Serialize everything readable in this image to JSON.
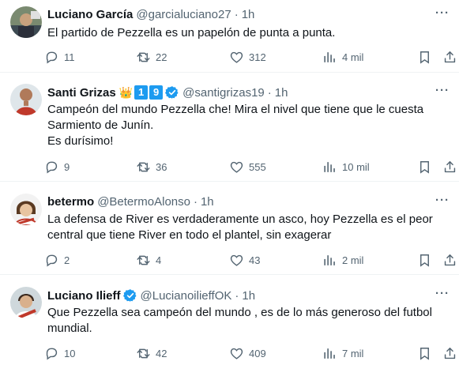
{
  "tweets": [
    {
      "name": "Luciano García",
      "handle": "@garcialuciano27",
      "time": "1h",
      "lines": [
        "El partido de Pezzella es un papelón de punta a punta."
      ],
      "replies": "11",
      "retweets": "22",
      "likes": "312",
      "views": "4 mil"
    },
    {
      "name": "Santi Grizas",
      "badge_emoji": "👑",
      "badge_nums": [
        "1",
        "9"
      ],
      "handle": "@santigrizas19",
      "time": "1h",
      "lines": [
        "Campeón del mundo Pezzella che! Mira el nivel que tiene que le cuesta",
        "Sarmiento de Junín.",
        "Es durísimo!"
      ],
      "replies": "9",
      "retweets": "36",
      "likes": "555",
      "views": "10 mil"
    },
    {
      "name": "betermo",
      "handle": "@BetermoAlonso",
      "time": "1h",
      "lines": [
        "La defensa de River es verdaderamente un asco, hoy Pezzella es el peor",
        "central que tiene River en todo el plantel, sin exagerar"
      ],
      "replies": "2",
      "retweets": "4",
      "likes": "43",
      "views": "2 mil"
    },
    {
      "name": "Luciano Ilieff",
      "handle": "@LucianoilieffOK",
      "time": "1h",
      "lines": [
        "Que Pezzella sea campeón del mundo , es de lo más generoso del futbol",
        "mundial."
      ],
      "replies": "10",
      "retweets": "42",
      "likes": "409",
      "views": "7 mil"
    }
  ],
  "dot": "·",
  "more_label": "···",
  "colors": {
    "verified": "#1d9bf0",
    "secondary_text": "#536471",
    "divider": "#eff3f4"
  }
}
